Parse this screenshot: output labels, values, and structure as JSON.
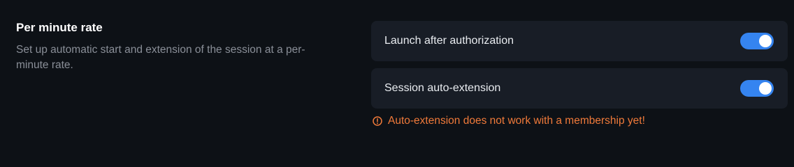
{
  "section": {
    "title": "Per minute rate",
    "description": "Set up automatic start and extension of the session at a per-minute rate."
  },
  "settings": [
    {
      "label": "Launch after authorization",
      "enabled": true,
      "toggle_icon": "toggle-switch"
    },
    {
      "label": "Session auto-extension",
      "enabled": true,
      "toggle_icon": "toggle-switch"
    }
  ],
  "warning": {
    "icon": "warning-circle-icon",
    "text": "Auto-extension does not work with a membership yet!"
  },
  "colors": {
    "background": "#0d1116",
    "card": "#181d26",
    "toggle_on": "#3584f0",
    "warning": "#f07a3a",
    "muted_text": "#8a8f98"
  }
}
